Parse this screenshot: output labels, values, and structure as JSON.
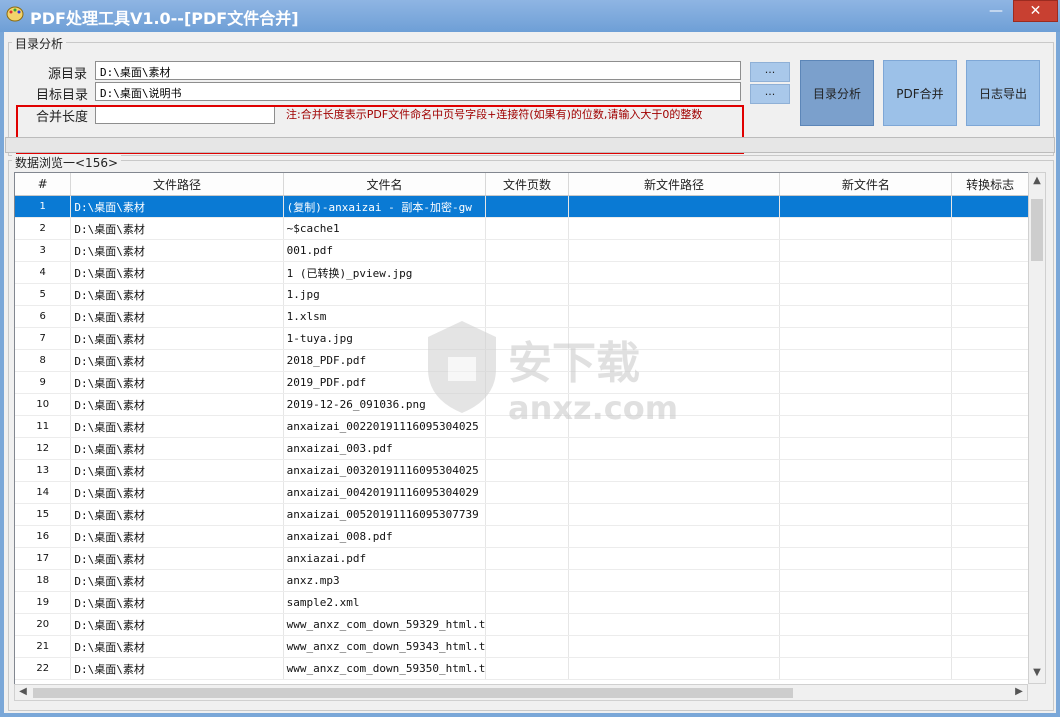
{
  "window": {
    "title": "PDF处理工具V1.0--[PDF文件合并]",
    "minimize": "—",
    "maximize": "☐",
    "close": "✕"
  },
  "dir_group": {
    "label": "目录分析",
    "source_label": "源目录",
    "source_value": "D:\\桌面\\素材",
    "target_label": "目标目录",
    "target_value": "D:\\桌面\\说明书",
    "merge_length_label": "合并长度",
    "merge_length_value": "",
    "browse_label": "...",
    "note": "注:合并长度表示PDF文件命名中页号字段+连接符(如果有)的位数,请输入大于0的整数",
    "buttons": {
      "analyze": "目录分析",
      "merge": "PDF合并",
      "export_log": "日志导出"
    }
  },
  "data_group": {
    "label": "数据浏览一<156>",
    "columns": [
      "#",
      "文件路径",
      "文件名",
      "文件页数",
      "新文件路径",
      "新文件名",
      "转换标志"
    ],
    "rows": [
      {
        "n": "1",
        "path": "D:\\桌面\\素材",
        "name": "(复制)-anxaizai - 副本-加密-gw"
      },
      {
        "n": "2",
        "path": "D:\\桌面\\素材",
        "name": "~$cache1"
      },
      {
        "n": "3",
        "path": "D:\\桌面\\素材",
        "name": "001.pdf"
      },
      {
        "n": "4",
        "path": "D:\\桌面\\素材",
        "name": "1 (已转换)_pview.jpg"
      },
      {
        "n": "5",
        "path": "D:\\桌面\\素材",
        "name": "1.jpg"
      },
      {
        "n": "6",
        "path": "D:\\桌面\\素材",
        "name": "1.xlsm"
      },
      {
        "n": "7",
        "path": "D:\\桌面\\素材",
        "name": "1-tuya.jpg"
      },
      {
        "n": "8",
        "path": "D:\\桌面\\素材",
        "name": "2018_PDF.pdf"
      },
      {
        "n": "9",
        "path": "D:\\桌面\\素材",
        "name": "2019_PDF.pdf"
      },
      {
        "n": "10",
        "path": "D:\\桌面\\素材",
        "name": "2019-12-26_091036.png"
      },
      {
        "n": "11",
        "path": "D:\\桌面\\素材",
        "name": "anxaizai_00220191116095304025"
      },
      {
        "n": "12",
        "path": "D:\\桌面\\素材",
        "name": "anxaizai_003.pdf"
      },
      {
        "n": "13",
        "path": "D:\\桌面\\素材",
        "name": "anxaizai_00320191116095304025"
      },
      {
        "n": "14",
        "path": "D:\\桌面\\素材",
        "name": "anxaizai_00420191116095304029"
      },
      {
        "n": "15",
        "path": "D:\\桌面\\素材",
        "name": "anxaizai_00520191116095307739"
      },
      {
        "n": "16",
        "path": "D:\\桌面\\素材",
        "name": "anxaizai_008.pdf"
      },
      {
        "n": "17",
        "path": "D:\\桌面\\素材",
        "name": "anxiazai.pdf"
      },
      {
        "n": "18",
        "path": "D:\\桌面\\素材",
        "name": "anxz.mp3"
      },
      {
        "n": "19",
        "path": "D:\\桌面\\素材",
        "name": "sample2.xml"
      },
      {
        "n": "20",
        "path": "D:\\桌面\\素材",
        "name": "www_anxz_com_down_59329_html.t"
      },
      {
        "n": "21",
        "path": "D:\\桌面\\素材",
        "name": "www_anxz_com_down_59343_html.t"
      },
      {
        "n": "22",
        "path": "D:\\桌面\\素材",
        "name": "www_anxz_com_down_59350_html.t"
      }
    ]
  },
  "watermark": {
    "text": "安下载",
    "sub": "anxz.com"
  },
  "colors": {
    "selection": "#0a7ad4",
    "note": "#a00000",
    "title_bar": "#7aa7d8"
  }
}
